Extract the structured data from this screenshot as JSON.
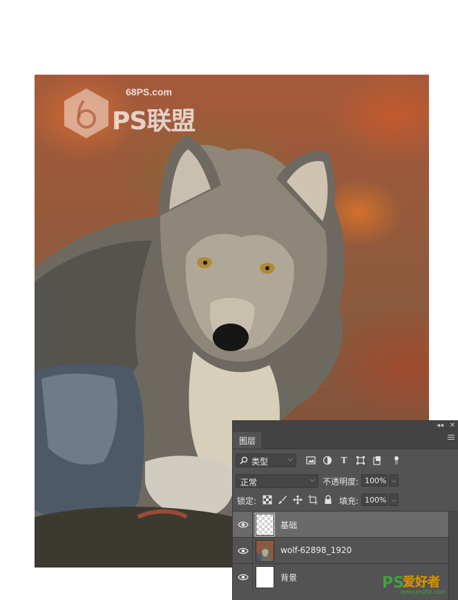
{
  "watermark": {
    "url": "68PS.com",
    "brand": "PS联盟"
  },
  "layers_panel": {
    "tab_label": "图层",
    "filter": {
      "selected": "类型"
    },
    "blend_mode": "正常",
    "opacity_label": "不透明度:",
    "opacity_value": "100%",
    "lock_label": "锁定:",
    "fill_label": "填充:",
    "fill_value": "100%",
    "layers": [
      {
        "name": "基础",
        "selected": true,
        "visible": true,
        "thumb": "transparent"
      },
      {
        "name": "wolf-62898_1920",
        "selected": false,
        "visible": true,
        "thumb": "wolf-photo"
      },
      {
        "name": "背景",
        "selected": false,
        "visible": true,
        "thumb": "white"
      }
    ]
  },
  "site_watermark": {
    "logo_text": "PS",
    "slogan": "爱好者",
    "url": "www.psahz.com"
  },
  "colors": {
    "panel_bg": "#535353",
    "selected_layer": "#6a6a6a",
    "site_green": "#3fa33f"
  },
  "icons": [
    "search-icon",
    "image-filter-icon",
    "adjustment-filter-icon",
    "type-filter-icon",
    "shape-filter-icon",
    "smartobject-filter-icon",
    "eye-icon",
    "lock-pixels-icon",
    "brush-lock-icon",
    "move-lock-icon",
    "artboard-lock-icon",
    "lock-all-icon",
    "panel-menu-icon"
  ]
}
